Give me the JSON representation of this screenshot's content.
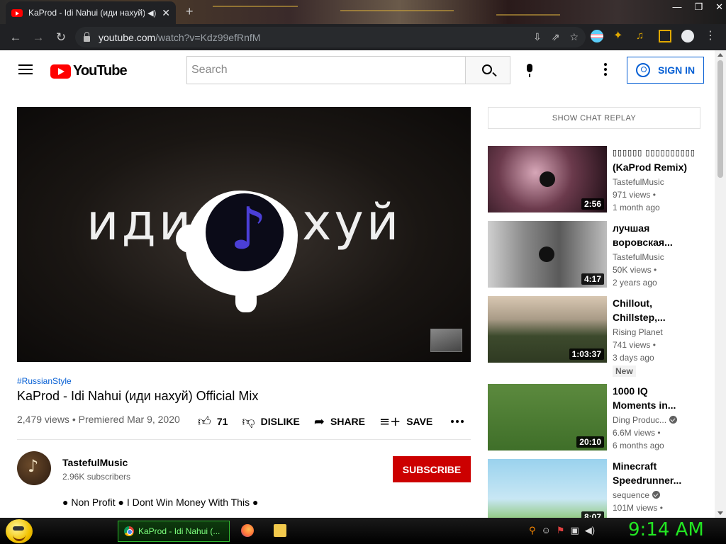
{
  "browser": {
    "tab": {
      "title": "KaProd - Idi Nahui (иди нахуй) Off",
      "audio_icon": "speaker-icon",
      "close_icon": "close-icon"
    },
    "new_tab_icon": "plus-icon",
    "window_buttons": [
      "minimize-icon",
      "restore-icon",
      "close-icon"
    ],
    "nav": {
      "back": "←",
      "forward": "→",
      "reload": "↻"
    },
    "url_host": "youtube.com",
    "url_path": "/watch?v=Kdz99efRnfM",
    "omnibox_icons": [
      "install-icon",
      "share-icon",
      "bookmark-star-icon"
    ],
    "extensions": [
      "translate-icon",
      "puzzle-icon",
      "media-icon",
      "side-panel-icon",
      "profile-icon",
      "menu-icon"
    ]
  },
  "youtube": {
    "logo_text": "YouTube",
    "search_placeholder": "Search",
    "sign_in": "SIGN IN",
    "video": {
      "overlay_left": "иди",
      "overlay_right": "хуй",
      "hashtag": "#RussianStyle",
      "title": "KaProd - Idi Nahui (иди нахуй) Official Mix",
      "meta": "2,479 views • Premiered Mar 9, 2020",
      "likes": "71",
      "dislike": "DISLIKE",
      "share": "SHARE",
      "save": "SAVE"
    },
    "channel": {
      "name": "TastefulMusic",
      "subscribers": "2.96K subscribers",
      "subscribe": "SUBSCRIBE",
      "description": "● Non Profit ● I Dont Win Money With This ●"
    },
    "chat_replay": "SHOW CHAT REPLAY",
    "recommendations": [
      {
        "title_1": "▯▯▯▯▯▯ ▯▯▯▯▯▯▯▯▯▯",
        "title_2": "(KaProd Remix)",
        "channel": "TastefulMusic",
        "views": "971 views •",
        "age": "1 month ago",
        "duration": "2:56",
        "verified": false,
        "badge": ""
      },
      {
        "title_1": "лучшая",
        "title_2": "воровская...",
        "channel": "TastefulMusic",
        "views": "50K views •",
        "age": "2 years ago",
        "duration": "4:17",
        "verified": false,
        "badge": ""
      },
      {
        "title_1": "Chillout,",
        "title_2": "Chillstep,...",
        "channel": "Rising Planet",
        "views": "741 views •",
        "age": "3 days ago",
        "duration": "1:03:37",
        "verified": false,
        "badge": "New"
      },
      {
        "title_1": "1000 IQ",
        "title_2": "Moments in...",
        "channel": "Ding Produc...",
        "views": "6.6M views •",
        "age": "6 months ago",
        "duration": "20:10",
        "verified": true,
        "badge": ""
      },
      {
        "title_1": "Minecraft",
        "title_2": "Speedrunner...",
        "channel": "sequence",
        "views": "101M views •",
        "age": "",
        "duration": "8:07",
        "verified": true,
        "badge": ""
      }
    ]
  },
  "taskbar": {
    "task_title": "KaProd - Idi Nahui (...",
    "clock": "9:14 AM",
    "tray_icons": [
      "search-icon",
      "face-icon",
      "flag-icon",
      "network-icon",
      "volume-icon"
    ]
  }
}
